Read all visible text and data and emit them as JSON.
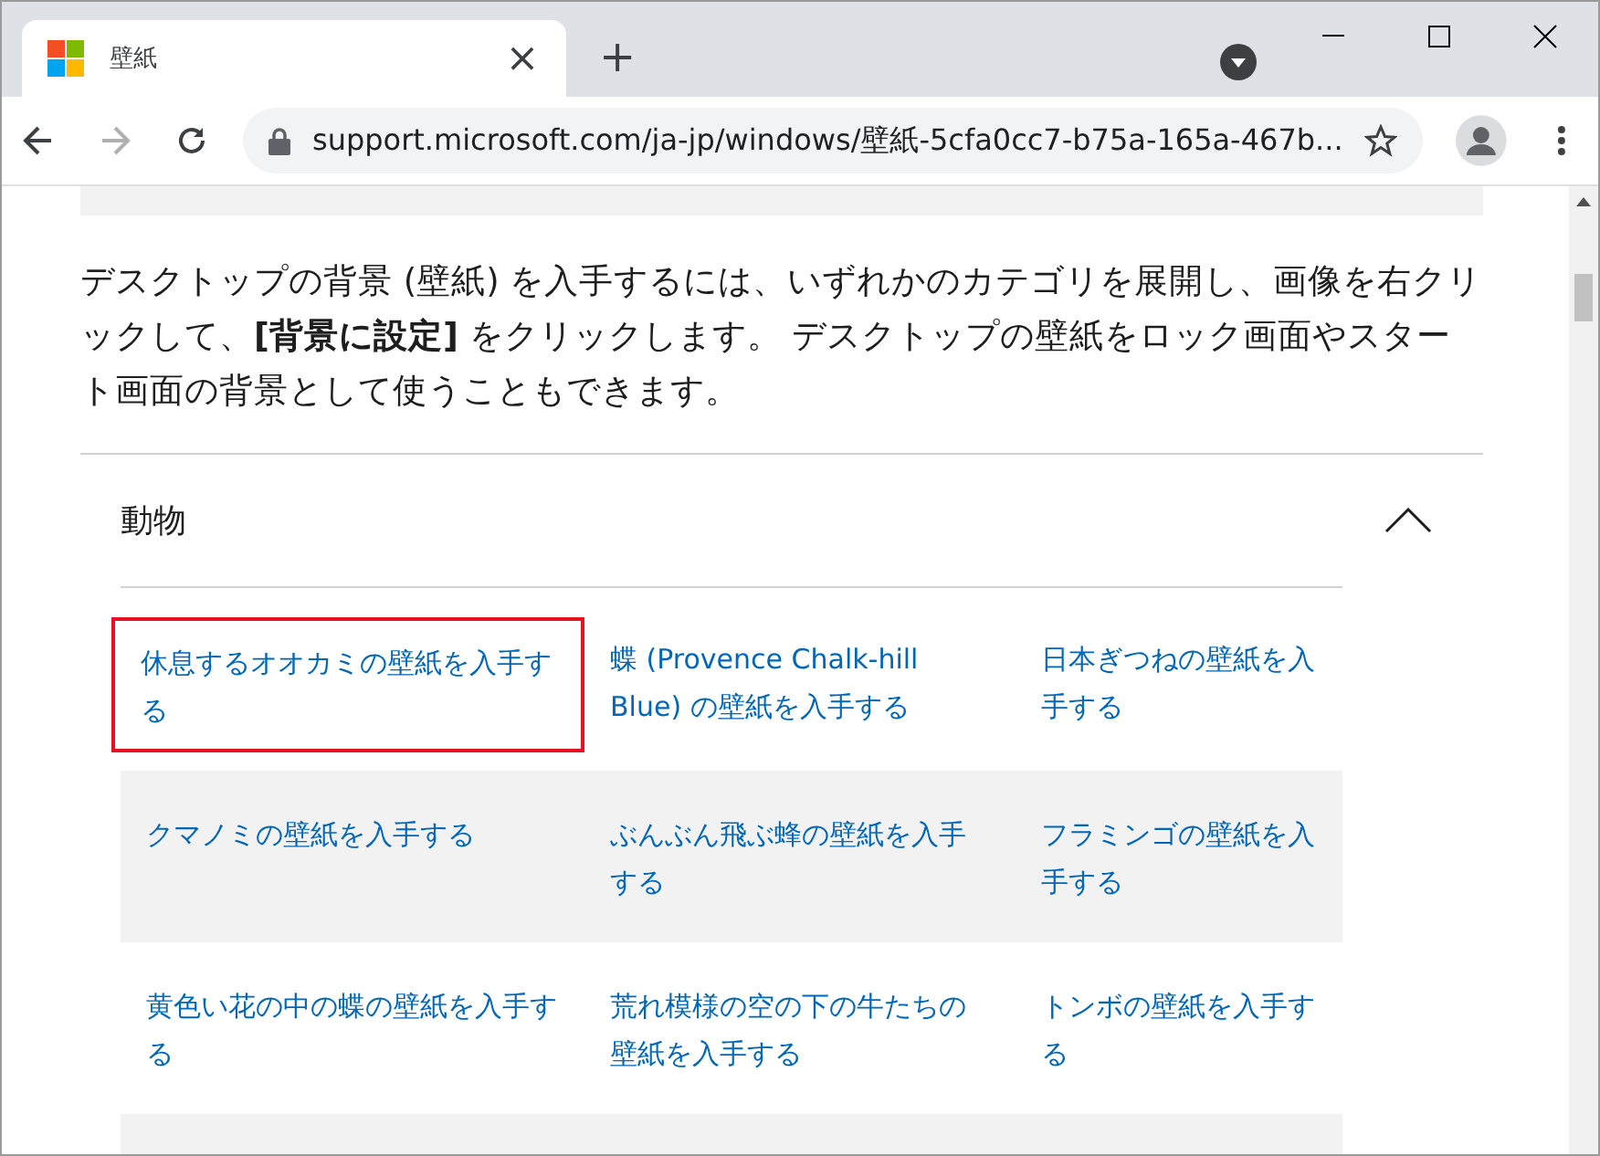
{
  "tab": {
    "title": "壁紙",
    "close": "×",
    "new_tab": "+"
  },
  "address_bar": {
    "url": "support.microsoft.com/ja-jp/windows/壁紙-5cfa0cc7-b75a-165a-467b..."
  },
  "intro": "デスクトップの背景 (壁紙) を入手するには、いずれかのカテゴリを展開し、画像を右クリックして、**[背景に設定]** をクリックします。 デスクトップの壁紙をロック画面やスタート画面の背景として使うこともできます。",
  "accordion": {
    "title": "動物",
    "expanded": true,
    "links": [
      {
        "text": "休息するオオカミの壁紙を入手する",
        "highlighted": true
      },
      {
        "text": "蝶 (Provence Chalk-hill Blue) の壁紙を入手する",
        "highlighted": false
      },
      {
        "text": "日本ぎつねの壁紙を入手する",
        "highlighted": false
      },
      {
        "text": "クマノミの壁紙を入手する",
        "highlighted": false
      },
      {
        "text": "ぶんぶん飛ぶ蜂の壁紙を入手する",
        "highlighted": false
      },
      {
        "text": "フラミンゴの壁紙を入手する",
        "highlighted": false
      },
      {
        "text": "黄色い花の中の蝶の壁紙を入手する",
        "highlighted": false
      },
      {
        "text": "荒れ模様の空の下の牛たちの壁紙を入手する",
        "highlighted": false
      },
      {
        "text": "トンボの壁紙を入手する",
        "highlighted": false
      }
    ]
  }
}
